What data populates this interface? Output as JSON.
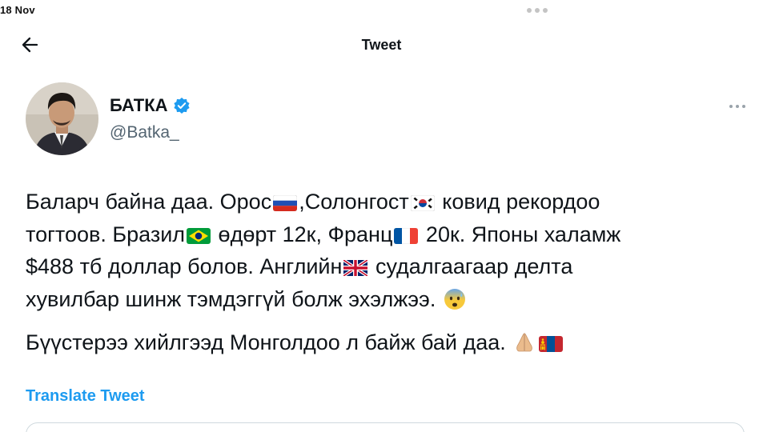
{
  "status_bar": {
    "date": "18 Nov"
  },
  "header": {
    "title": "Tweet"
  },
  "author": {
    "name": "БАТКА",
    "handle": "@Batka_"
  },
  "tweet": {
    "p1": {
      "l1a": "Баларч байна даа. Орос",
      "l1b": ",Солонгост",
      "l1c": " ковид рекордоо",
      "l2a": "тогтоов. Бразил",
      "l2b": " өдөрт 12к, Франц",
      "l2c": " 20к. Японы халамж",
      "l3": "$488 тб доллар болов. Английн",
      "l3b": " судалгаагаар делта",
      "l4": "хувилбар шинж тэмдэггүй болж эхэлжээ. "
    },
    "p2": "Бүүстерээ хийлгээд Монголдоо л байж бай даа. "
  },
  "flags": [
    "russia-flag",
    "south-korea-flag",
    "brazil-flag",
    "france-flag",
    "uk-flag",
    "mongolia-flag"
  ],
  "emojis": [
    "anxious-face-emoji",
    "folded-hands-emoji"
  ],
  "translate_label": "Translate Tweet",
  "colors": {
    "accent": "#1d9bf0",
    "text": "#0f1419",
    "secondary": "#536471"
  }
}
